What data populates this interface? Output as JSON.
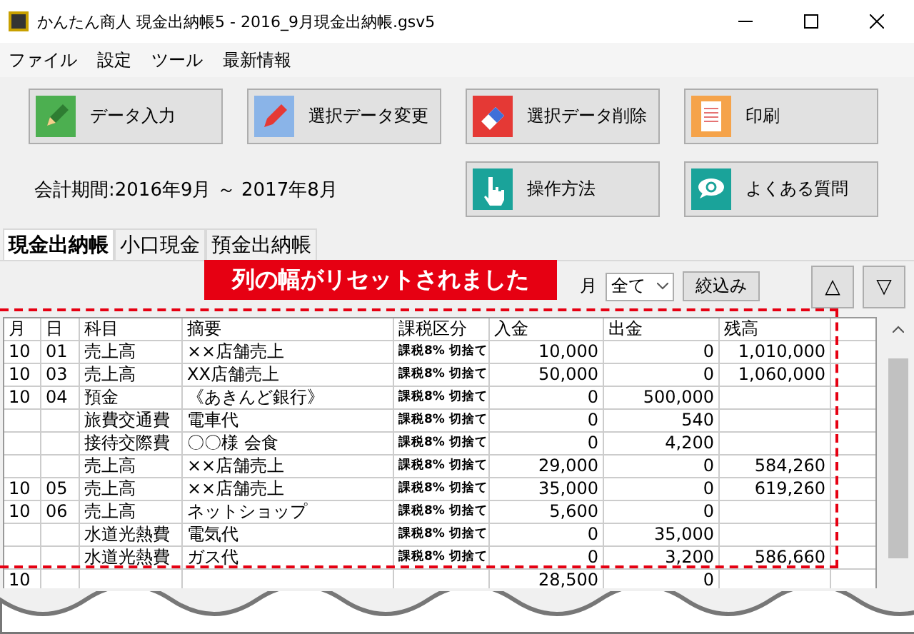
{
  "window": {
    "title": "かんたん商人 現金出納帳5 - 2016_9月現金出納帳.gsv5"
  },
  "menu": [
    "ファイル",
    "設定",
    "ツール",
    "最新情報"
  ],
  "buttons": [
    {
      "label": "データ入力",
      "kind": "input"
    },
    {
      "label": "選択データ変更",
      "kind": "edit"
    },
    {
      "label": "選択データ削除",
      "kind": "delete"
    },
    {
      "label": "印刷",
      "kind": "print"
    }
  ],
  "period": "会計期間:2016年9月 ～ 2017年8月",
  "help_buttons": [
    {
      "label": "操作方法",
      "kind": "howto"
    },
    {
      "label": "よくある質問",
      "kind": "faq"
    }
  ],
  "tabs": [
    {
      "label": "現金出納帳",
      "selected": true
    },
    {
      "label": "小口現金",
      "selected": false
    },
    {
      "label": "預金出納帳",
      "selected": false
    }
  ],
  "notice": "列の幅がリセットされました",
  "filter": {
    "month_label": "月",
    "month_value": "全て",
    "apply": "絞込み",
    "up": "△",
    "down": "▽"
  },
  "table": {
    "columns": [
      "月",
      "日",
      "科目",
      "摘要",
      "課税区分",
      "入金",
      "出金",
      "残高"
    ],
    "rows": [
      {
        "cells": [
          "10",
          "01",
          "売上高",
          "××店舗売上",
          "課税8% 切捨て",
          "10,000",
          "0",
          "1,010,000"
        ]
      },
      {
        "cells": [
          "10",
          "03",
          "売上高",
          "XX店舗売上",
          "課税8% 切捨て",
          "50,000",
          "0",
          "1,060,000"
        ]
      },
      {
        "cells": [
          "10",
          "04",
          "預金",
          "《あきんど銀行》",
          "課税8% 切捨て",
          "0",
          "500,000",
          ""
        ]
      },
      {
        "cells": [
          "",
          "",
          "旅費交通費",
          "電車代",
          "課税8% 切捨て",
          "0",
          "540",
          ""
        ]
      },
      {
        "cells": [
          "",
          "",
          "接待交際費",
          "〇〇様 会食",
          "課税8% 切捨て",
          "0",
          "4,200",
          ""
        ]
      },
      {
        "cells": [
          "",
          "",
          "売上高",
          "××店舗売上",
          "課税8% 切捨て",
          "29,000",
          "0",
          "584,260"
        ]
      },
      {
        "cells": [
          "10",
          "05",
          "売上高",
          "××店舗売上",
          "課税8% 切捨て",
          "35,000",
          "0",
          "619,260"
        ]
      },
      {
        "cells": [
          "10",
          "06",
          "売上高",
          "ネットショップ",
          "課税8% 切捨て",
          "5,600",
          "0",
          ""
        ]
      },
      {
        "cells": [
          "",
          "",
          "水道光熱費",
          "電気代",
          "課税8% 切捨て",
          "0",
          "35,000",
          ""
        ]
      },
      {
        "cells": [
          "",
          "",
          "水道光熱費",
          "ガス代",
          "課税8% 切捨て",
          "0",
          "3,200",
          "586,660"
        ]
      },
      {
        "cells": [
          "10",
          "",
          "",
          "",
          "",
          "28,500",
          "0",
          ""
        ]
      }
    ]
  }
}
